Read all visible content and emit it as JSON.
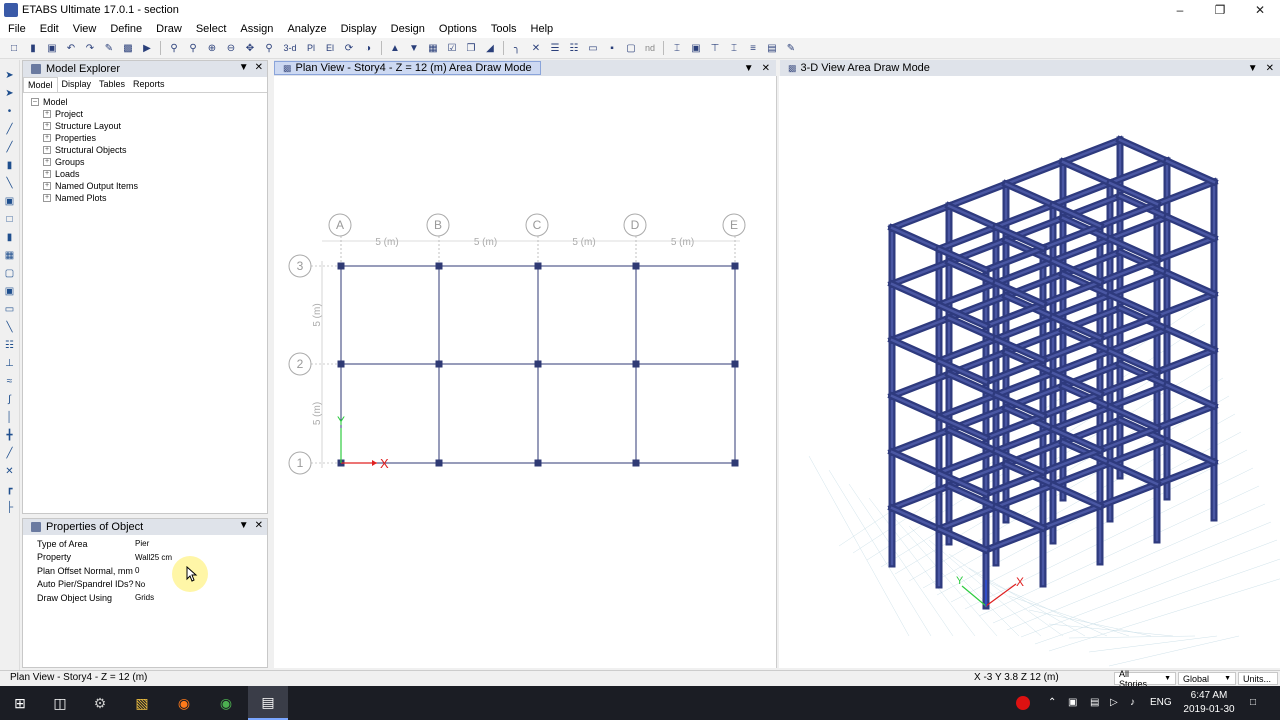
{
  "window": {
    "title": "ETABS Ultimate 17.0.1 - section"
  },
  "menu": [
    "File",
    "Edit",
    "View",
    "Define",
    "Draw",
    "Select",
    "Assign",
    "Analyze",
    "Display",
    "Design",
    "Options",
    "Tools",
    "Help"
  ],
  "toolbar": {
    "view_3d": "3-d",
    "view_plan": "Pl",
    "view_elev": "El",
    "nd_label": "nd"
  },
  "model_explorer": {
    "title": "Model Explorer",
    "tabs": [
      "Model",
      "Display",
      "Tables",
      "Reports"
    ],
    "root": "Model",
    "items": [
      "Project",
      "Structure Layout",
      "Properties",
      "Structural Objects",
      "Groups",
      "Loads",
      "Named Output Items",
      "Named Plots"
    ]
  },
  "properties": {
    "title": "Properties of Object",
    "rows": [
      {
        "key": "Type of Area",
        "value": "Pier"
      },
      {
        "key": "Property",
        "value": "Wall25 cm"
      },
      {
        "key": "Plan Offset Normal, mm",
        "value": "0"
      },
      {
        "key": "Auto Pier/Spandrel IDs?",
        "value": "No"
      },
      {
        "key": "Draw Object Using",
        "value": "Grids"
      }
    ]
  },
  "plan_view": {
    "title": "Plan View - Story4 - Z = 12 (m)  Area Draw Mode",
    "col_grids": [
      "A",
      "B",
      "C",
      "D",
      "E"
    ],
    "row_grids": [
      "3",
      "2",
      "1"
    ],
    "span_label": "5 (m)",
    "axis_y": "Y",
    "axis_x": "X"
  },
  "view_3d": {
    "title": "3-D View  Area Draw Mode"
  },
  "status": {
    "left": "Plan View - Story4 - Z = 12 (m)",
    "coords": "X -3  Y 3.8  Z 12 (m)",
    "stories": "All Stories",
    "coord_sys": "Global",
    "units": "Units..."
  },
  "taskbar": {
    "lang": "ENG",
    "time": "6:47 AM",
    "date": "2019-01-30"
  },
  "colors": {
    "frame_blue": "#2e3a7e",
    "grid_line": "#2f3a74",
    "axis_red": "#e02020",
    "axis_green": "#2ecc40"
  }
}
